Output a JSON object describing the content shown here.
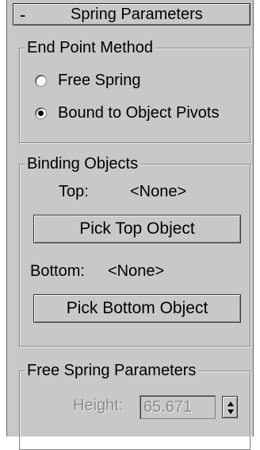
{
  "rollout": {
    "collapse_symbol": "-",
    "title": "Spring Parameters"
  },
  "end_point_method": {
    "title": "End Point Method",
    "options": [
      {
        "label": "Free Spring",
        "selected": false
      },
      {
        "label": "Bound to Object Pivots",
        "selected": true
      }
    ]
  },
  "binding_objects": {
    "title": "Binding Objects",
    "top_label": "Top:",
    "top_value": "<None>",
    "pick_top_button": "Pick Top Object",
    "bottom_label": "Bottom:",
    "bottom_value": "<None>",
    "pick_bottom_button": "Pick Bottom Object"
  },
  "free_spring_parameters": {
    "title": "Free Spring Parameters",
    "height_label": "Height:",
    "height_value": "65.671",
    "enabled": false
  },
  "colors": {
    "panel_background": "#c8c8c8",
    "disabled_text": "#8c8c8c"
  }
}
